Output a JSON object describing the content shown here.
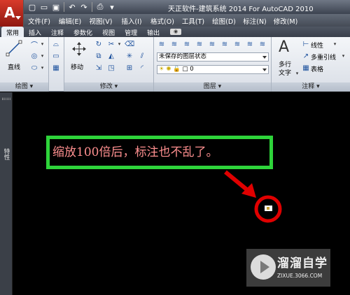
{
  "window": {
    "title": "天正软件-建筑系统 2014  For AutoCAD 2010"
  },
  "menu": [
    "文件(F)",
    "编辑(E)",
    "视图(V)",
    "插入(I)",
    "格式(O)",
    "工具(T)",
    "绘图(D)",
    "标注(N)",
    "修改(M)"
  ],
  "ribbon_tabs": [
    "常用",
    "插入",
    "注释",
    "参数化",
    "视图",
    "管理",
    "输出"
  ],
  "active_tab": "常用",
  "panels": {
    "draw": {
      "title": "绘图",
      "line_label": "直线"
    },
    "modify": {
      "title": "修改",
      "move_label": "移动"
    },
    "layers": {
      "title": "图层",
      "layer_state": "未保存的图层状态",
      "current_layer": "0"
    },
    "annotation": {
      "title": "注释",
      "multiline_text_label1": "多行",
      "multiline_text_label2": "文字",
      "linear_label": "线性",
      "multileader_label": "多重引线",
      "table_label": "表格"
    }
  },
  "side_palette_label": "特性",
  "canvas": {
    "annotation_text": "缩放100倍后，标注也不乱了。",
    "box_color": "#2ed43a",
    "text_color": "#ff9090",
    "highlight_color": "#e00000"
  },
  "watermark": {
    "title": "溜溜自学",
    "url": "ZIXUE.3066.COM"
  }
}
